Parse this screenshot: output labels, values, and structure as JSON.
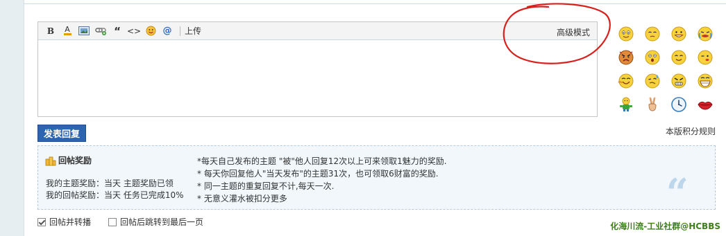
{
  "toolbar": {
    "bold": "B",
    "font_color": "A",
    "quote": "“",
    "code": "<>",
    "at": "@",
    "upload": "上传",
    "advanced_mode": "高级模式"
  },
  "smileys": [
    "smile",
    "shy",
    "grin",
    "cry",
    "angry",
    "surprised",
    "happy",
    "wink",
    "laugh",
    "sweat",
    "mad",
    "big-grin",
    "figure",
    "victory",
    "clock",
    "lips"
  ],
  "submit_label": "发表回复",
  "rules_link": "本版积分规则",
  "reward": {
    "title": "回帖奖励",
    "my_topic": "我的主题奖励：当天 主题奖励已领",
    "my_reply": "我的回帖奖励：当天 任务已完成10%",
    "rules": [
      "*每天自己发布的主题 \"被\"他人回复12次以上可来领取1魅力的奖励.",
      "* 每天你回复他人\"当天发布\"的主题31次，也可领取6财富的奖励.",
      "* 同一主题的重复回复不计,每天一次.",
      "* 无意义灌水被扣分更多"
    ],
    "quote_mark": "“"
  },
  "options": {
    "reply_and_share": "回帖并转播",
    "jump_last_page": "回帖后跳转到最后一页"
  },
  "watermark": "化海川流-工业社群@HCBBS",
  "colors": {
    "accent": "#2c64b0",
    "annotation_red": "#d8201c",
    "watermark_green": "#3e7d1c"
  }
}
